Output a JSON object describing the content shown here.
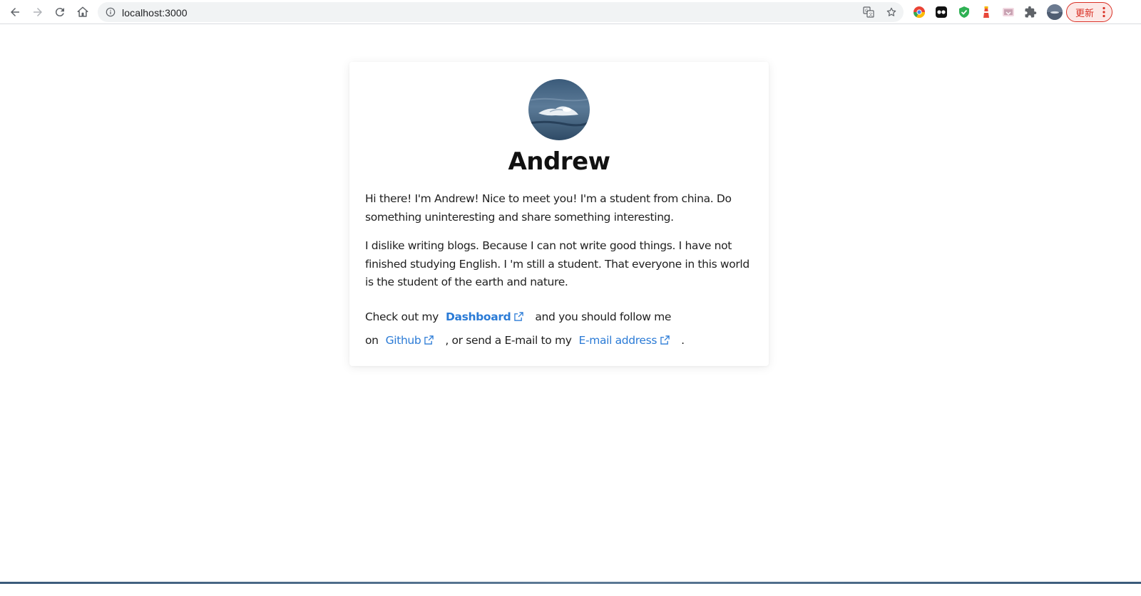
{
  "browser": {
    "url": "localhost:3000",
    "update_label": "更新"
  },
  "profile": {
    "name": "Andrew",
    "intro": "Hi there! I'm Andrew! Nice to meet you! I'm a student from china. Do something uninteresting and share something interesting.",
    "bio": "I dislike writing blogs. Because I can not write good things. I have not finished studying English. I 'm still a student. That everyone in this world is the student of the earth and nature.",
    "links_sentence": {
      "part1": "Check out my",
      "dashboard_label": "Dashboard",
      "part2": "and you should follow me on",
      "github_label": "Github",
      "part3": ", or send a E-mail to my",
      "email_label": "E-mail address",
      "part4": "."
    }
  },
  "colors": {
    "link": "#2b7bd6",
    "update_accent": "#d93025"
  }
}
